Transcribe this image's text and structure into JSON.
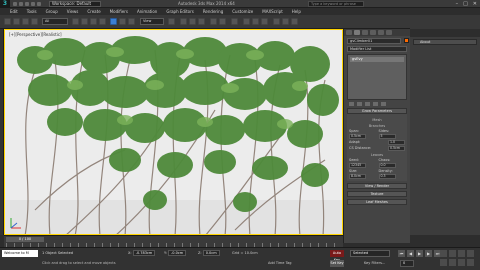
{
  "app": {
    "logo_glyph": "3",
    "workspace": "Workspace: Default",
    "window_title": "Autodesk 3ds Max 2014 x64",
    "search_placeholder": "Type a keyword or phrase",
    "controls": [
      "–",
      "□",
      "✕"
    ]
  },
  "menu": [
    "Edit",
    "Tools",
    "Group",
    "Views",
    "Create",
    "Modifiers",
    "Animation",
    "Graph Editors",
    "Rendering",
    "Customize",
    "MAXScript",
    "Help"
  ],
  "toolbar": {
    "selection_filter": "All",
    "view_ref": "View"
  },
  "viewport": {
    "label": "[+][Perspective][Realistic]"
  },
  "command_panel": {
    "object_name": "gvClimber01",
    "swatch_color": "#ff6a00",
    "modifier_list": "Modifier List",
    "stack_item": "gvEvy",
    "rollout_title": "Grow Parameters",
    "mesh_group": "Mesh",
    "branches_group": "Branches",
    "params": {
      "span_label": "Span:",
      "span_val": "0.5cm",
      "sides_label": "Sides:",
      "sides_val": "5",
      "adapt_label": "Adapt:",
      "adapt_val": "1.0",
      "cs_label": "CS Distance:",
      "cs_val": "0.5cm"
    },
    "leaves_group": "Leaves",
    "leaf_params": {
      "seed_label": "Seed:",
      "seed_val": "12345",
      "chaos_label": "Chaos:",
      "chaos_val": "0.0",
      "size_label": "Size:",
      "size_val": "8.0cm",
      "density_label": "Density:",
      "density_val": "0.3"
    },
    "bottom_rollouts": [
      "View / Render",
      "Texture",
      "Leaf Meshes"
    ]
  },
  "side_panel": {
    "about": "About"
  },
  "timeline": {
    "slider": "0 / 100"
  },
  "status": {
    "maxscript": "Welcome to M",
    "line1": "1 Object Selected",
    "line2": "Click and drag to select and move objects",
    "x_label": "X:",
    "x_val": "-0.783cm",
    "y_label": "Y:",
    "y_val": "-0.0cm",
    "z_label": "Z:",
    "z_val": "0.0cm",
    "grid": "Grid = 10.0cm",
    "add_time_tag": "Add Time Tag",
    "auto_key": "Auto Key",
    "set_key": "Set Key",
    "selected": "Selected",
    "key_filters": "Key Filters...",
    "frame": "0"
  }
}
